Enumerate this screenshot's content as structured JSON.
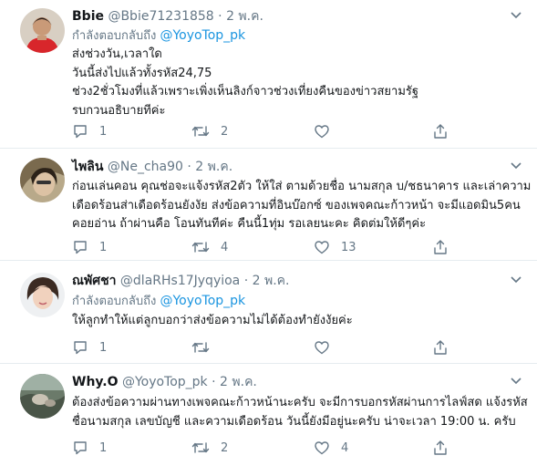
{
  "reply_prefix": "กำลังตอบกลับถึง",
  "tweets": [
    {
      "name": "Bbie",
      "handle": "@Bbie71231858",
      "dot": "·",
      "date": "2 พ.ค.",
      "reply_to": "@YoyoTop_pk",
      "lines": [
        "ส่งช่วงวัน,เวลาใด",
        "วันนี้ส่งไปแล้วทั้งรหัส24,75",
        "ช่วง2ชั่วโมงที่แล้วเพราะเพิ่งเห็นลิงก์จาวช่วงเที่ยงคืนของข่าวสยามรัฐ",
        "รบกวนอธิบายทีค่ะ"
      ],
      "replies": "1",
      "retweets": "2",
      "likes": ""
    },
    {
      "name": "ไพลิน",
      "handle": "@Ne_cha90",
      "dot": "·",
      "date": "2 พ.ค.",
      "reply_to": "",
      "lines": [
        "ก่อนเล่นคอน คุณช่อจะแจ้งรหัส2ตัว ให้ใส่ ตามด้วยชื่อ นามสกุล บ/ชธนาคาร และเล่าความ",
        "เดือดร้อนส่าเดือดร้อนยังงัย ส่งข้อความที่อินบ๊อกซ์ ของเพจคณะก้าวหน้า จะมีแอดมิน5คน",
        "คอยอ่าน ถ้าผ่านคือ โอนทันทีค่ะ คืนนี้1ทุ่ม รอเลยนะคะ คิดต่มให้ดีๆค่ะ"
      ],
      "replies": "1",
      "retweets": "4",
      "likes": "13"
    },
    {
      "name": "ณพัศชา",
      "handle": "@dlaRHs17Jyqyioa",
      "dot": "·",
      "date": "2 พ.ค.",
      "reply_to": "@YoyoTop_pk",
      "lines": [
        "ให้ลูกทำให้แต่ลูกบอกว่าส่งข้อความไม่ได้ต้องทำยังงัยค่ะ"
      ],
      "replies": "1",
      "retweets": "",
      "likes": ""
    },
    {
      "name": "Why.O",
      "handle": "@YoyoTop_pk",
      "dot": "·",
      "date": "2 พ.ค.",
      "reply_to": "",
      "lines": [
        "ต้องส่งข้อความผ่านทางเพจคณะก้าวหน้านะครับ จะมีการบอกรหัสผ่านการไลฟ์สด แจ้งรหัส",
        "ชื่อนามสกุล เลขบัญชี และความเดือดร้อน วันนี้ยังมีอยู่นะครับ น่าจะเวลา 19:00 น. ครับ"
      ],
      "replies": "1",
      "retweets": "2",
      "likes": "4"
    }
  ]
}
